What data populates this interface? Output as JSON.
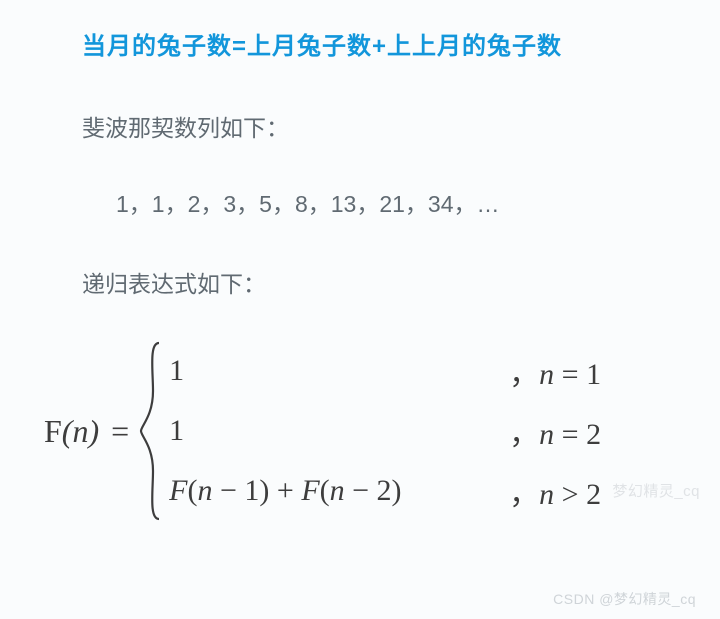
{
  "title": "当月的兔子数=上月兔子数+上上月的兔子数",
  "desc1": "斐波那契数列如下：",
  "sequence": "1，1，2，3，5，8，13，21，34，…",
  "desc2": "递归表达式如下：",
  "formula": {
    "lhs": "F(n)",
    "eq": "=",
    "cases": [
      {
        "expr": "1",
        "cond": "，n = 1"
      },
      {
        "expr": "1",
        "cond": "，n = 2"
      },
      {
        "expr": "F(n − 1) + F(n − 2)",
        "cond": "，n > 2"
      }
    ]
  },
  "watermark_upper": "梦幻精灵_cq",
  "watermark_lower": "CSDN @梦幻精灵_cq"
}
